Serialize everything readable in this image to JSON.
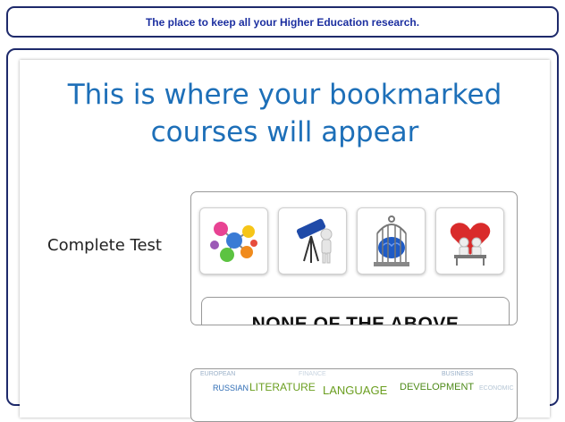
{
  "banner": {
    "text": "The place to keep all your Higher Education research."
  },
  "main": {
    "headline": "This is where your bookmarked courses will appear",
    "question_label": "Complete Test",
    "option_icons": [
      "molecule-network-icon",
      "telescope-figure-icon",
      "caged-brain-icon",
      "heart-couple-icon"
    ],
    "answer_label": "NONE OF THE ABOVE"
  },
  "word_cloud": {
    "words": [
      "EUROPEAN",
      "BUSINESS",
      "FINANCE",
      "RUSSIAN",
      "LITERATURE",
      "LANGUAGE",
      "DEVELOPMENT",
      "ECONOMIC"
    ]
  },
  "colors": {
    "banner_text": "#1c2fa0",
    "headline": "#1d6fb8",
    "border": "#1e2a6b",
    "cloud_green": "#6a9e1f"
  }
}
